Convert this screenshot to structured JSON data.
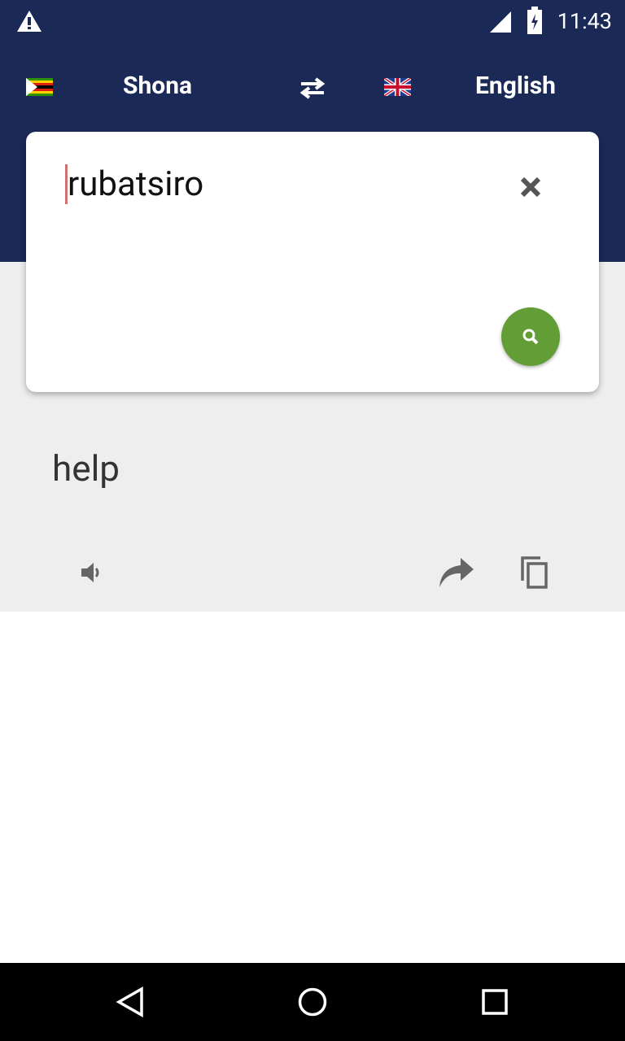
{
  "status": {
    "time": "11:43"
  },
  "header": {
    "source_lang": "Shona",
    "target_lang": "English",
    "colors": {
      "bar": "#1b2957",
      "accent": "#629d35"
    }
  },
  "input": {
    "value": "rubatsiro"
  },
  "result": {
    "text": "help"
  }
}
